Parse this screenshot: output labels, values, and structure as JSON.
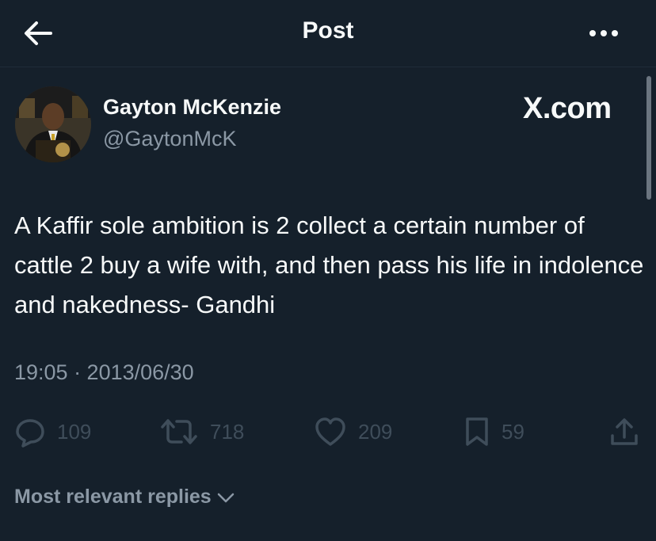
{
  "header": {
    "title": "Post",
    "back_icon": "arrow-left-icon",
    "more_icon": "more-horizontal-icon"
  },
  "post": {
    "author_name": "Gayton McKenzie",
    "author_handle": "@GaytonMcK",
    "watermark": "X.com",
    "text": "A Kaffir sole ambition is 2 collect a certain number of cattle 2 buy a wife with, and then pass his life in indolence and nakedness- Gandhi",
    "timestamp": "19:05 · 2013/06/30"
  },
  "actions": {
    "replies": "109",
    "reposts": "718",
    "likes": "209",
    "bookmarks": "59"
  },
  "replies_sort": {
    "label": "Most relevant replies"
  },
  "colors": {
    "background": "#15202b",
    "primary_text": "#f7f9f9",
    "secondary_text": "#8b98a5",
    "muted_icon": "#3f4d5a"
  }
}
